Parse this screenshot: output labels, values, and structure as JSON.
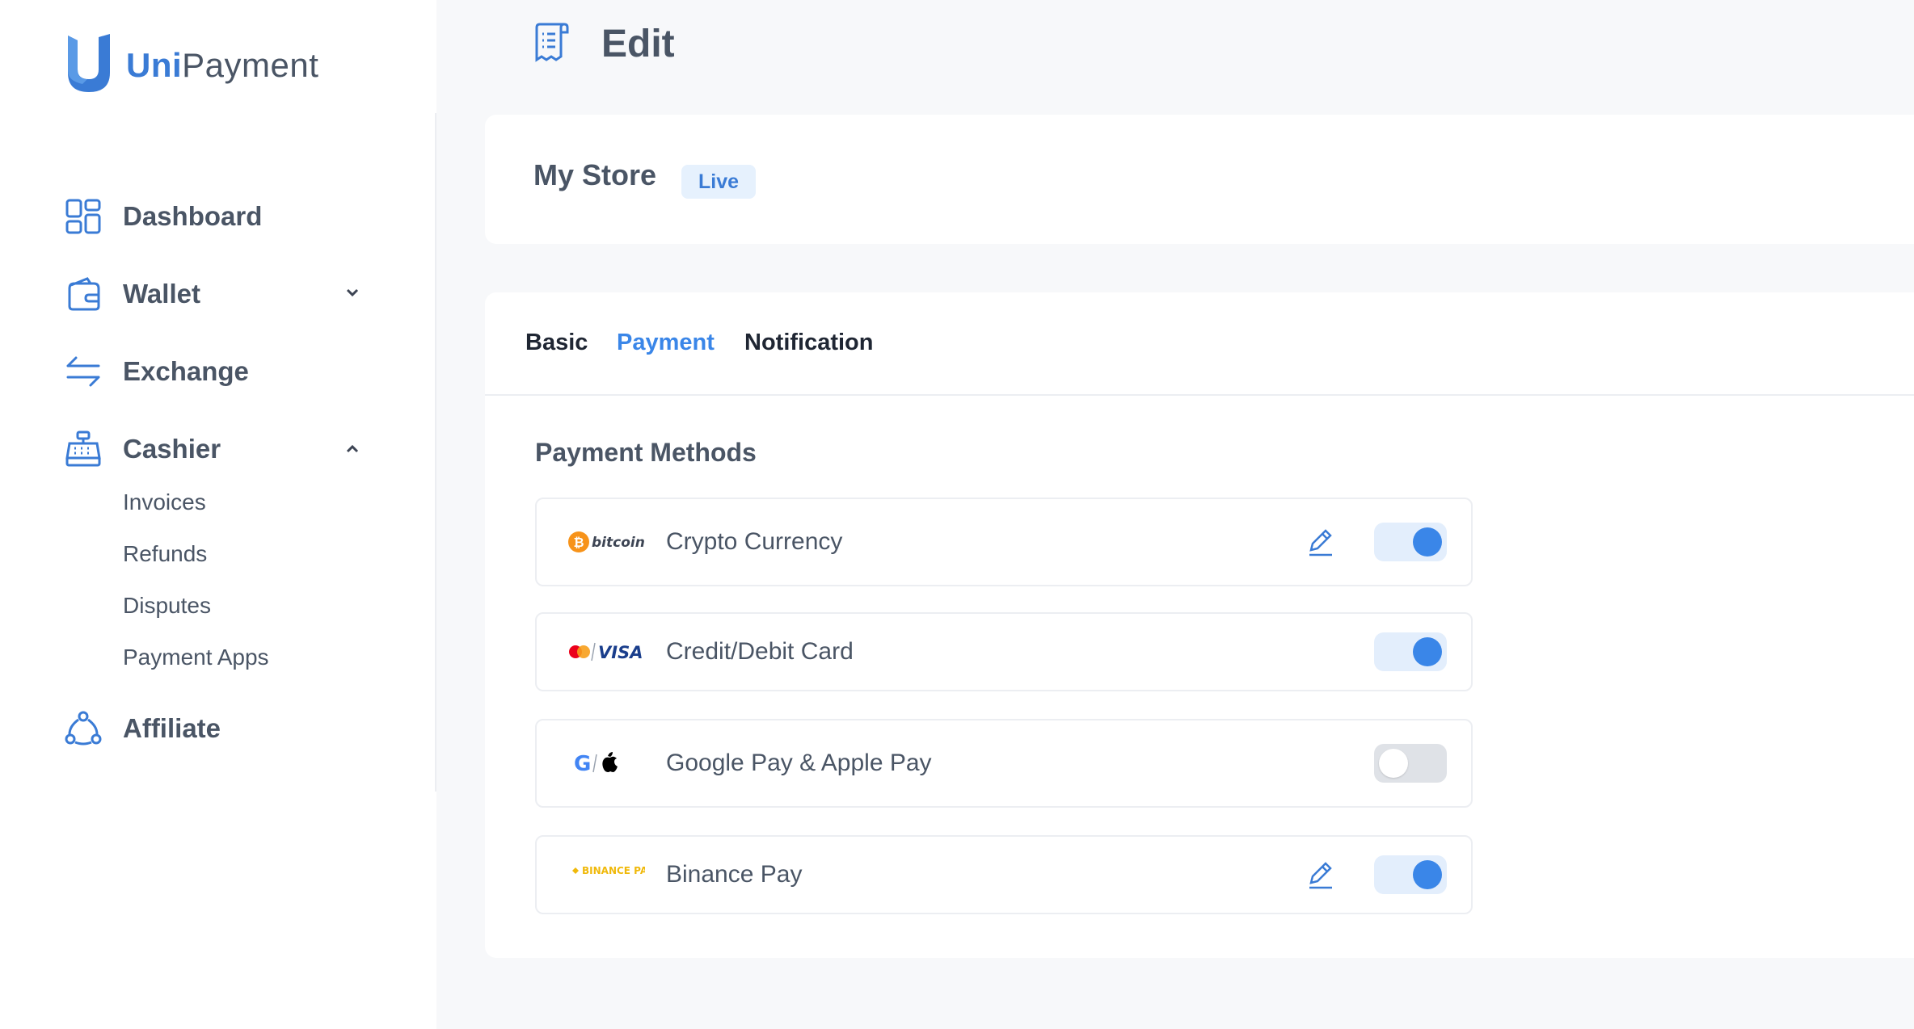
{
  "brand": {
    "name_prefix": "Uni",
    "name_suffix": "Payment",
    "color": "#3a7bd5"
  },
  "sidebar": {
    "items": [
      {
        "label": "Dashboard",
        "icon": "dashboard-icon"
      },
      {
        "label": "Wallet",
        "icon": "wallet-icon",
        "expanded": false
      },
      {
        "label": "Exchange",
        "icon": "exchange-icon"
      },
      {
        "label": "Cashier",
        "icon": "cashier-icon",
        "expanded": true,
        "children": [
          "Invoices",
          "Refunds",
          "Disputes",
          "Payment Apps"
        ]
      },
      {
        "label": "Affiliate",
        "icon": "affiliate-icon"
      }
    ]
  },
  "header": {
    "title": "Edit",
    "icon": "receipt-icon"
  },
  "store": {
    "name": "My Store",
    "status": "Live"
  },
  "tabs": [
    {
      "label": "Basic",
      "active": false
    },
    {
      "label": "Payment",
      "active": true
    },
    {
      "label": "Notification",
      "active": false
    }
  ],
  "payment": {
    "section_title": "Payment Methods",
    "methods": [
      {
        "label": "Crypto Currency",
        "logo": "bitcoin-logo",
        "logo_text": "bitcoin",
        "editable": true,
        "enabled": true
      },
      {
        "label": "Credit/Debit Card",
        "logo": "mastercard-visa-logo",
        "logo_text": "VISA",
        "editable": false,
        "enabled": true
      },
      {
        "label": "Google Pay & Apple Pay",
        "logo": "google-apple-logo",
        "logo_text": "G",
        "editable": false,
        "enabled": false
      },
      {
        "label": "Binance Pay",
        "logo": "binance-pay-logo",
        "logo_text": "BINANCE PAY",
        "editable": true,
        "enabled": true
      }
    ]
  },
  "colors": {
    "accent": "#3a86e8",
    "toggle_on_bg": "#e3eefc",
    "toggle_off_bg": "#dfe2e7",
    "badge_bg": "#e6f1fd"
  }
}
